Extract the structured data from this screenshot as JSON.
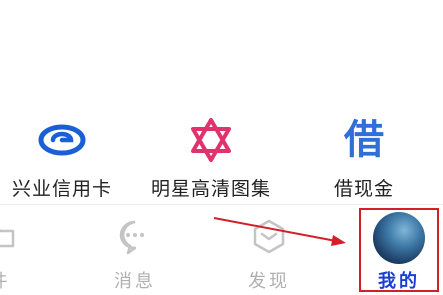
{
  "apps": [
    {
      "label": "兴业信用卡",
      "icon": "xingye-bank-icon",
      "color": "#1a5fd6"
    },
    {
      "label": "明星高清图集",
      "icon": "star-of-david-icon",
      "color": "#e0336e"
    },
    {
      "label": "借现金",
      "icon_text": "借",
      "icon": "cash-loan-icon",
      "color": "#2f6fd6"
    }
  ],
  "tabbar": {
    "tab_files": "件",
    "tab_messages": "消息",
    "tab_discover": "发现",
    "tab_me": "我的"
  },
  "colors": {
    "active_tab": "#1a3fd6",
    "inactive_tab": "#b0b0b0",
    "annotation": "#d0202a"
  }
}
